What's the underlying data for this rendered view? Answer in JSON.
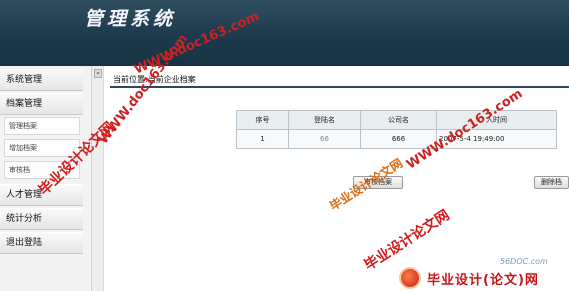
{
  "header": {
    "title": "管理系统"
  },
  "sidebar": {
    "collapse_glyph": "«",
    "items": [
      {
        "label": "系统管理"
      },
      {
        "label": "档案管理"
      },
      {
        "label": "管理档案"
      },
      {
        "label": "增加档案"
      },
      {
        "label": "审核档"
      },
      {
        "label": "人才管理"
      },
      {
        "label": "统计分析"
      },
      {
        "label": "退出登陆"
      }
    ]
  },
  "main": {
    "location": "当前位置:当前企业档案",
    "table": {
      "columns": [
        "序号",
        "登陆名",
        "公司名",
        "入时间"
      ],
      "rows": [
        [
          "1",
          "66",
          "666",
          "2007-5-4 19:49:00"
        ]
      ]
    },
    "buttons": {
      "audit": "审核档案",
      "delete": "删除档"
    }
  },
  "watermarks": {
    "site_text": "毕业设计论文网",
    "url": "WWW.doc163.com"
  },
  "footer": {
    "site_tag": "56DOC.com",
    "logo_text": "毕业设计(论文)网"
  }
}
